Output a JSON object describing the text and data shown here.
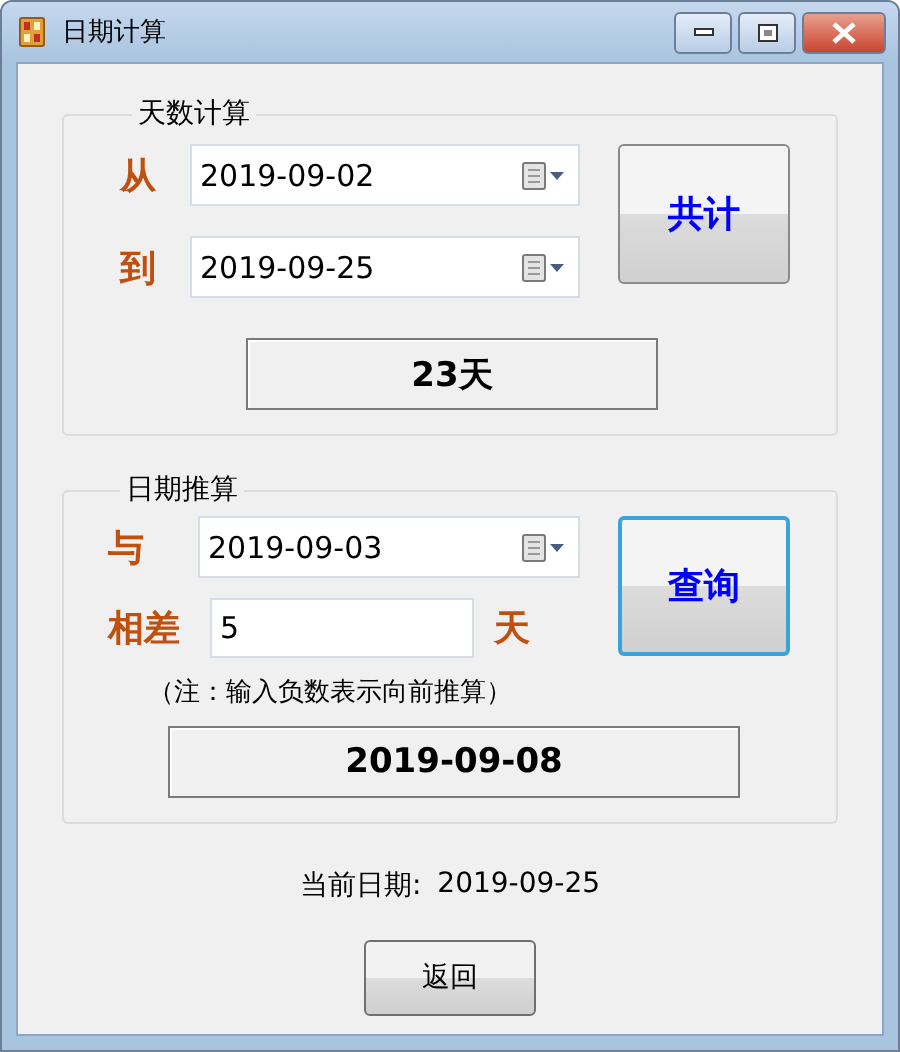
{
  "window": {
    "title": "日期计算"
  },
  "day_count": {
    "legend": "天数计算",
    "from": {
      "label": "从",
      "value": "2019-09-02"
    },
    "to": {
      "label": "到",
      "value": "2019-09-25"
    },
    "button": {
      "label": "共计",
      "focused": false
    },
    "result": "23天"
  },
  "date_calc": {
    "legend": "日期推算",
    "base": {
      "label": "与",
      "value": "2019-09-03"
    },
    "offset": {
      "label": "相差",
      "value": "5",
      "unit": "天"
    },
    "button": {
      "label": "查询",
      "focused": true
    },
    "note": "（注：输入负数表示向前推算）",
    "result": "2019-09-08"
  },
  "current_date": {
    "label": "当前日期:",
    "value": "2019-09-25"
  },
  "back_button": "返回"
}
